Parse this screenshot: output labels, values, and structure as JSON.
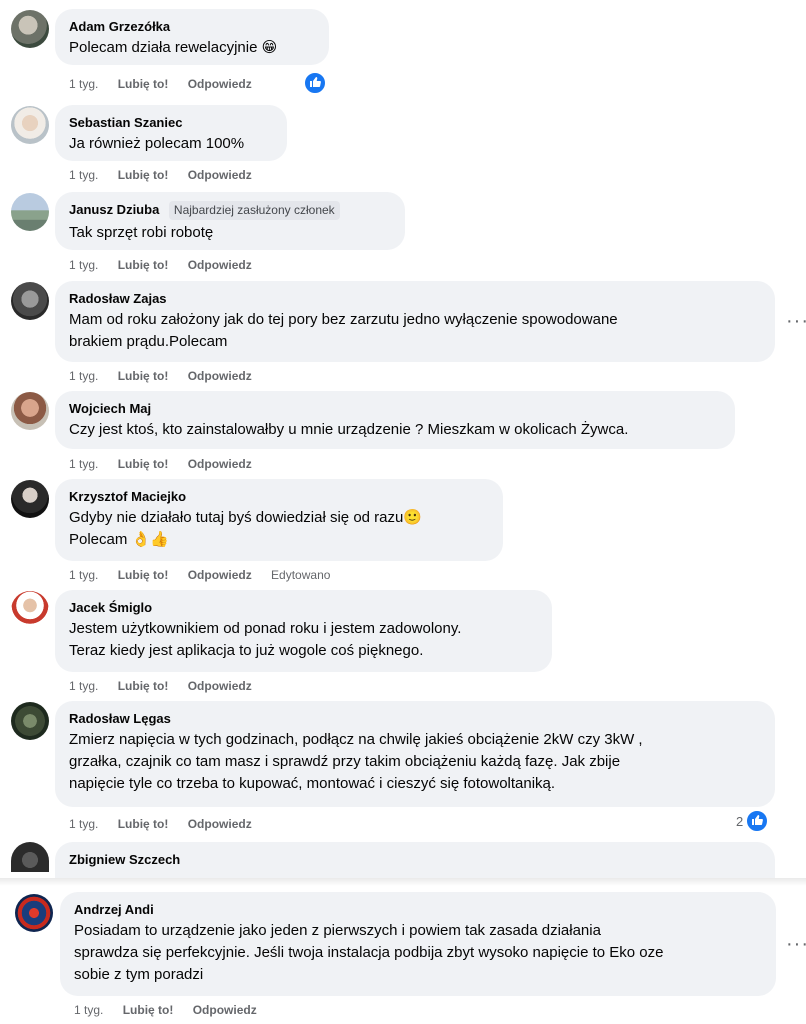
{
  "comments": [
    {
      "name": "Adam Grzezółka",
      "text": [
        "Polecam działa rewelacyjnie 😁"
      ],
      "time": "1 tyg.",
      "like": "Lubię to!",
      "reply": "Odpowiedz"
    },
    {
      "name": "Sebastian Szaniec",
      "text": [
        "Ja również polecam 100%"
      ],
      "time": "1 tyg.",
      "like": "Lubię to!",
      "reply": "Odpowiedz"
    },
    {
      "name": "Janusz Dziuba",
      "badge": "Najbardziej zasłużony członek",
      "text": [
        "Tak sprzęt robi robotę"
      ],
      "time": "1 tyg.",
      "like": "Lubię to!",
      "reply": "Odpowiedz"
    },
    {
      "name": "Radosław Zajas",
      "text": [
        "Mam od roku założony jak do tej pory bez zarzutu jedno wyłączenie spowodowane",
        "brakiem prądu.Polecam"
      ],
      "time": "1 tyg.",
      "like": "Lubię to!",
      "reply": "Odpowiedz"
    },
    {
      "name": "Wojciech Maj",
      "text": [
        "Czy jest ktoś, kto zainstalowałby u mnie urządzenie ? Mieszkam w okolicach Żywca."
      ],
      "time": "1 tyg.",
      "like": "Lubię to!",
      "reply": "Odpowiedz"
    },
    {
      "name": "Krzysztof Maciejko",
      "text": [
        "Gdyby nie działało tutaj byś dowiedział się od razu🙂",
        "Polecam 👌👍"
      ],
      "time": "1 tyg.",
      "like": "Lubię to!",
      "reply": "Odpowiedz",
      "edited": "Edytowano"
    },
    {
      "name": "Jacek Śmiglo",
      "text": [
        "Jestem użytkownikiem od ponad roku i jestem zadowolony.",
        "Teraz kiedy jest aplikacja to już wogole coś pięknego."
      ],
      "time": "1 tyg.",
      "like": "Lubię to!",
      "reply": "Odpowiedz"
    },
    {
      "name": "Radosław Lęgas",
      "text": [
        "Zmierz napięcia w tych godzinach, podłącz na chwilę jakieś obciążenie 2kW czy 3kW ,",
        "grzałka, czajnik co tam masz i sprawdź przy takim obciążeniu każdą fazę. Jak zbije",
        "napięcie tyle co trzeba to kupować, montować i cieszyć się fotowoltaniką."
      ],
      "time": "1 tyg.",
      "like": "Lubię to!",
      "reply": "Odpowiedz",
      "reactions": "2"
    },
    {
      "name": "Zbigniew Szczech"
    },
    {
      "name": "Andrzej Andi",
      "text": [
        "Posiadam to urządzenie jako jeden z pierwszych i powiem tak zasada działania",
        "sprawdza się perfekcyjnie. Jeśli twoja instalacja podbija zbyt wysoko napięcie to Eko oze",
        "sobie z tym poradzi"
      ],
      "time": "1 tyg.",
      "like": "Lubię to!",
      "reply": "Odpowiedz"
    }
  ],
  "colors": {
    "bubble": "#f0f2f5",
    "link": "#65676b",
    "like_blue": "#1877f2"
  },
  "icons": [
    "more-options-icon",
    "like-reaction-icon"
  ]
}
